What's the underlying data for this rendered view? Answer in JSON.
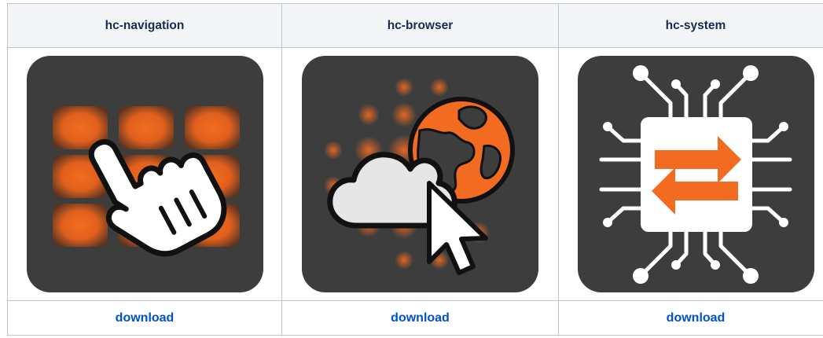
{
  "columns": [
    {
      "title": "hc-navigation",
      "icon": "hand-pointer-grid-icon",
      "link_label": "download"
    },
    {
      "title": "hc-browser",
      "icon": "cloud-globe-cursor-icon",
      "link_label": "download"
    },
    {
      "title": "hc-system",
      "icon": "chip-arrows-icon",
      "link_label": "download"
    }
  ],
  "colors": {
    "tile_bg": "#3d3d3d",
    "accent": "#f26b21",
    "header_bg": "#f4f5f7",
    "border": "#c1c7d0",
    "link": "#0052cc",
    "header_text": "#172b4d"
  }
}
